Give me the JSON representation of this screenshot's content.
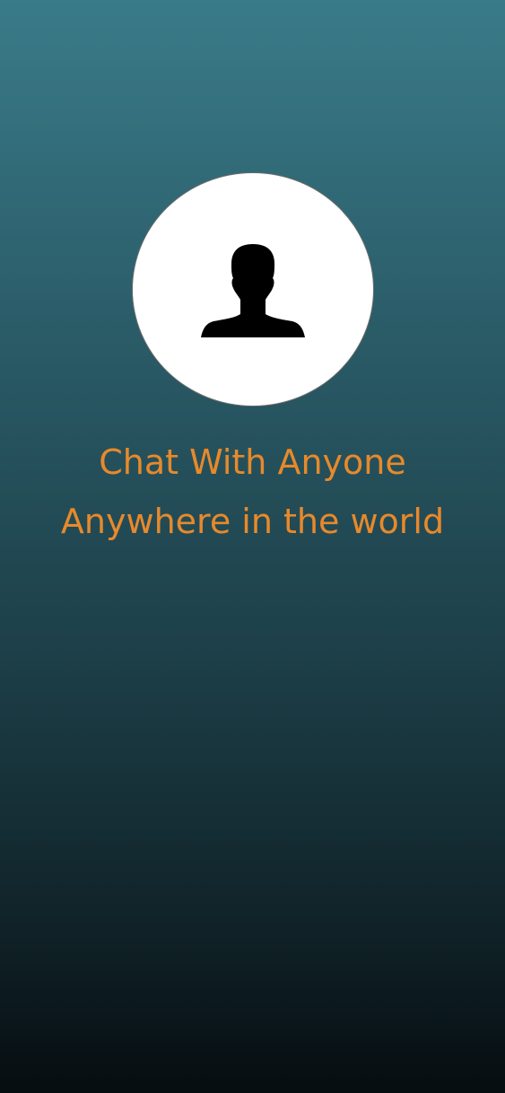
{
  "theme": {
    "accent": "#e8892b",
    "gradient_top": "#3a7b89",
    "gradient_bottom": "#060d10",
    "avatar_bg": "#ffffff"
  },
  "avatar": {
    "icon": "user-silhouette-icon"
  },
  "tagline": {
    "line1": "Chat With Anyone",
    "line2": "Anywhere in the world"
  }
}
